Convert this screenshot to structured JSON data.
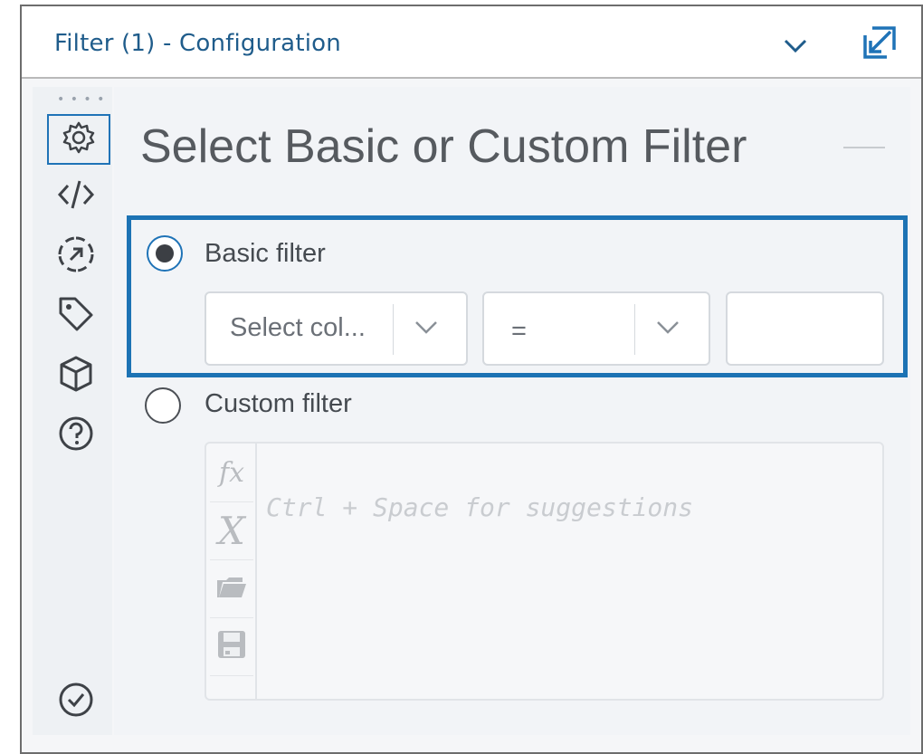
{
  "header": {
    "title": "Filter (1) - Configuration"
  },
  "sidebar": {
    "items": [
      {
        "name": "configuration",
        "icon": "gear-icon",
        "selected": true
      },
      {
        "name": "code",
        "icon": "code-icon"
      },
      {
        "name": "layout",
        "icon": "resize-icon"
      },
      {
        "name": "annotation",
        "icon": "tag-icon"
      },
      {
        "name": "output",
        "icon": "cube-icon"
      },
      {
        "name": "help",
        "icon": "help-icon"
      }
    ],
    "bottom_icon": "check-circle-icon"
  },
  "main": {
    "heading": "Select Basic or Custom Filter",
    "basic": {
      "label": "Basic filter",
      "selected": true,
      "column_select": "Select col...",
      "operator_select": "=",
      "value": ""
    },
    "custom": {
      "label": "Custom filter",
      "selected": false,
      "placeholder": "Ctrl + Space for suggestions",
      "toolbar": {
        "fx_label": "fx",
        "variable_label": "X"
      }
    }
  },
  "colors": {
    "accent": "#1f73b7",
    "title": "#1f5c8b",
    "highlight_border": "#1d73b4"
  }
}
